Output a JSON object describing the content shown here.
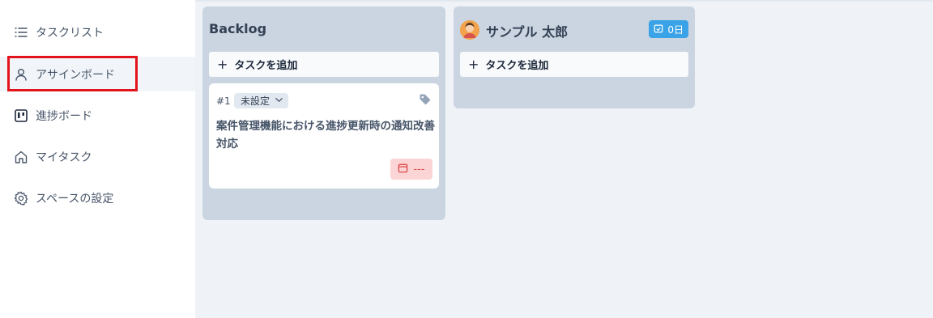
{
  "sidebar": {
    "items": [
      {
        "label": "タスクリスト",
        "icon": "list-icon"
      },
      {
        "label": "アサインボード",
        "icon": "user-icon"
      },
      {
        "label": "進捗ボード",
        "icon": "kanban-icon"
      },
      {
        "label": "マイタスク",
        "icon": "home-icon"
      },
      {
        "label": "スペースの設定",
        "icon": "gear-icon"
      }
    ],
    "active_index": 1
  },
  "board": {
    "columns": [
      {
        "title": "Backlog",
        "add_label": "タスクを追加",
        "cards": [
          {
            "number": "#1",
            "status": "未設定",
            "title": "案件管理機能における進捗更新時の通知改善対応",
            "due": "---"
          }
        ]
      },
      {
        "user_name": "サンプル 太郎",
        "badge": "0日",
        "add_label": "タスクを追加"
      }
    ]
  },
  "colors": {
    "highlight": "#e3131b",
    "column_bg": "#cbd5e1",
    "badge_blue": "#3aa2e6",
    "due_bg": "#fbd5d5",
    "due_text": "#e0474c"
  }
}
